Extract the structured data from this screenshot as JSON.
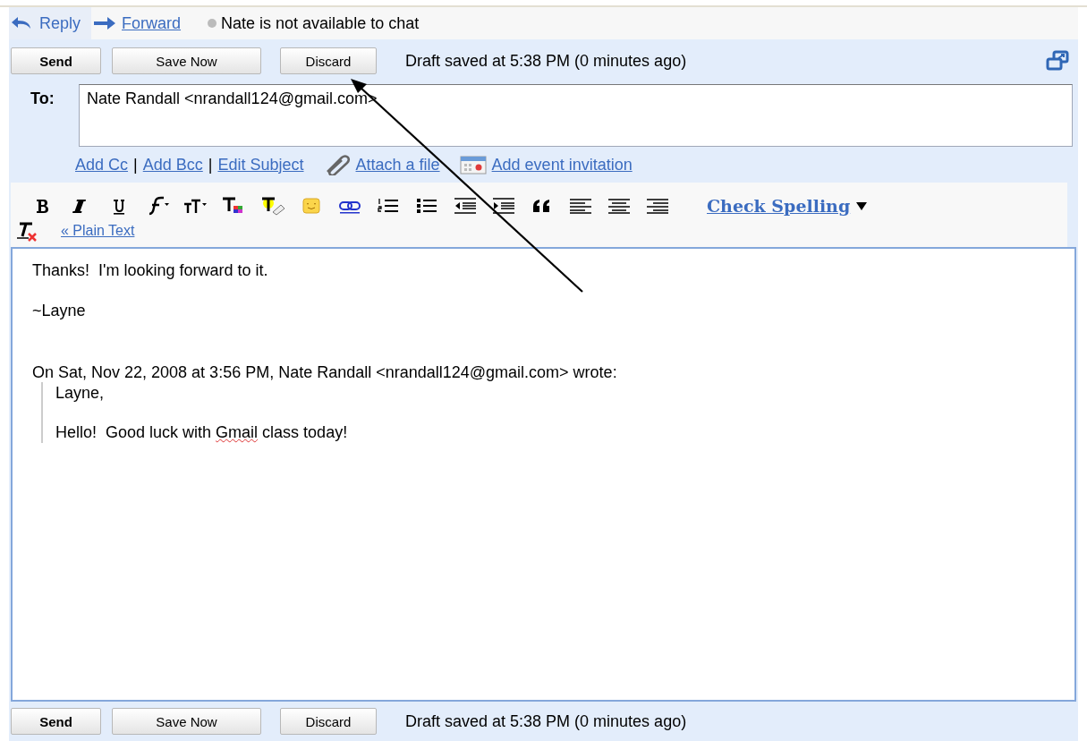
{
  "actions": [
    {
      "kind": "reply",
      "label": "Reply",
      "selected": true
    },
    {
      "kind": "forward",
      "label": "Forward",
      "selected": false
    }
  ],
  "chat_status": "Nate is not available to chat",
  "top_buttons": [
    {
      "label": "Send",
      "kind": "primary"
    },
    {
      "label": "Save Now",
      "kind": "normal"
    },
    {
      "label": "Discard",
      "kind": "normal"
    }
  ],
  "top_draft_status": "Draft saved at 5:38 PM (0 minutes ago)",
  "to": {
    "label": "To:",
    "value": "Nate Randall <nrandall124@gmail.com>"
  },
  "field_links": [
    "Add Cc",
    "Add Bcc",
    "Edit Subject"
  ],
  "field_link_separator": "|",
  "attach_link": "Attach a file",
  "event_link": "Add event invitation",
  "check_spelling": "Check Spelling",
  "plain_text_link": "« Plain Text",
  "body": [
    {
      "kind": "line",
      "parts": [
        {
          "text": "Thanks!  I'm looking forward to it.",
          "misspelled": false
        }
      ]
    },
    {
      "kind": "line",
      "parts": [
        {
          "text": "~Layne",
          "misspelled": false
        }
      ]
    },
    {
      "kind": "gap"
    },
    {
      "kind": "line",
      "parts": [
        {
          "text": "On Sat, Nov 22, 2008 at 3:56 PM, Nate Randall <nrandall124@gmail.com> wrote:",
          "misspelled": false
        }
      ]
    },
    {
      "kind": "quote",
      "lines": [
        {
          "kind": "text",
          "parts": [
            {
              "text": "Layne,",
              "misspelled": false
            }
          ]
        },
        {
          "kind": "gap"
        },
        {
          "kind": "text",
          "parts": [
            {
              "text": "Hello!  Good luck with ",
              "misspelled": false
            },
            {
              "text": "Gmail",
              "misspelled": true
            },
            {
              "text": " class today!",
              "misspelled": false
            }
          ]
        }
      ]
    }
  ],
  "bottom_buttons": [
    {
      "label": "Send",
      "kind": "primary"
    },
    {
      "label": "Save Now",
      "kind": "normal"
    },
    {
      "label": "Discard",
      "kind": "normal"
    }
  ],
  "bottom_draft_status": "Draft saved at 5:38 PM (0 minutes ago)"
}
